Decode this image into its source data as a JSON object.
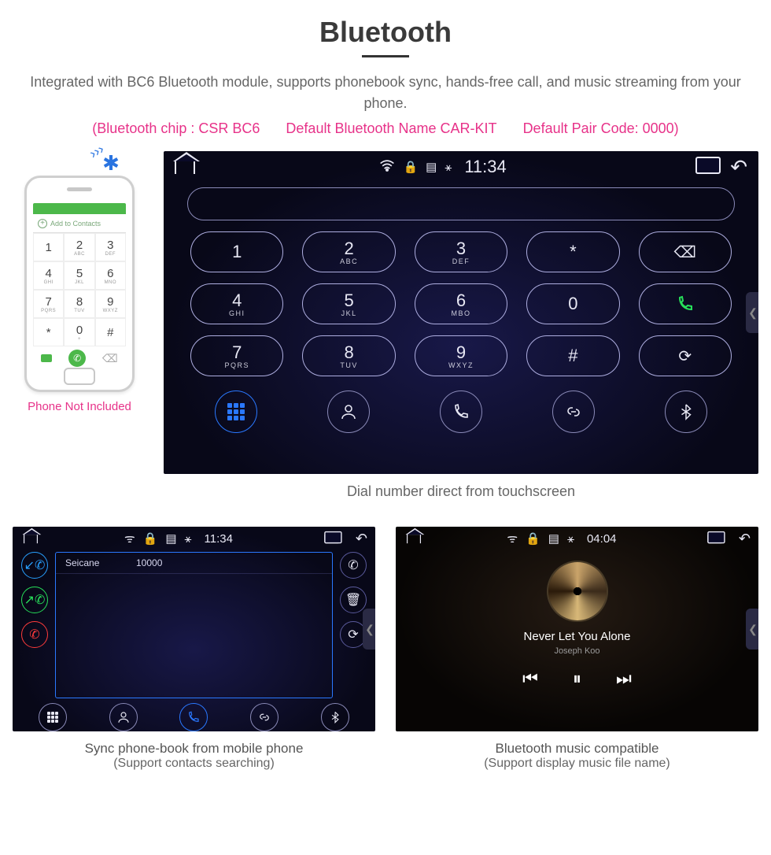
{
  "heading": "Bluetooth",
  "subtitle": "Integrated with BC6 Bluetooth module, supports phonebook sync, hands-free call, and music streaming from your phone.",
  "pink_specs": {
    "chip": "(Bluetooth chip : CSR BC6",
    "name": "Default Bluetooth Name CAR-KIT",
    "pair": "Default Pair Code: 0000)"
  },
  "phone": {
    "add_contacts": "Add to Contacts",
    "keys": [
      {
        "d": "1",
        "l": ""
      },
      {
        "d": "2",
        "l": "ABC"
      },
      {
        "d": "3",
        "l": "DEF"
      },
      {
        "d": "4",
        "l": "GHI"
      },
      {
        "d": "5",
        "l": "JKL"
      },
      {
        "d": "6",
        "l": "MNO"
      },
      {
        "d": "7",
        "l": "PQRS"
      },
      {
        "d": "8",
        "l": "TUV"
      },
      {
        "d": "9",
        "l": "WXYZ"
      },
      {
        "d": "*",
        "l": ""
      },
      {
        "d": "0",
        "l": "+"
      },
      {
        "d": "#",
        "l": ""
      }
    ],
    "caption": "Phone Not Included"
  },
  "dialer": {
    "time": "11:34",
    "keys": [
      {
        "d": "1",
        "l": ""
      },
      {
        "d": "2",
        "l": "ABC"
      },
      {
        "d": "3",
        "l": "DEF"
      },
      {
        "d": "*",
        "l": ""
      },
      {
        "icon": "backspace"
      },
      {
        "d": "4",
        "l": "GHI"
      },
      {
        "d": "5",
        "l": "JKL"
      },
      {
        "d": "6",
        "l": "MBO"
      },
      {
        "d": "0",
        "l": ""
      },
      {
        "icon": "call"
      },
      {
        "d": "7",
        "l": "PQRS"
      },
      {
        "d": "8",
        "l": "TUV"
      },
      {
        "d": "9",
        "l": "WXYZ"
      },
      {
        "d": "#",
        "l": ""
      },
      {
        "icon": "swap"
      }
    ],
    "caption": "Dial number direct from touchscreen"
  },
  "phonebook": {
    "time": "11:34",
    "entry": {
      "name": "Seicane",
      "number": "10000"
    },
    "caption_line1": "Sync phone-book from mobile phone",
    "caption_line2": "(Support contacts searching)"
  },
  "music": {
    "time": "04:04",
    "track": "Never Let You Alone",
    "artist": "Joseph Koo",
    "caption_line1": "Bluetooth music compatible",
    "caption_line2": "(Support display music file name)"
  }
}
